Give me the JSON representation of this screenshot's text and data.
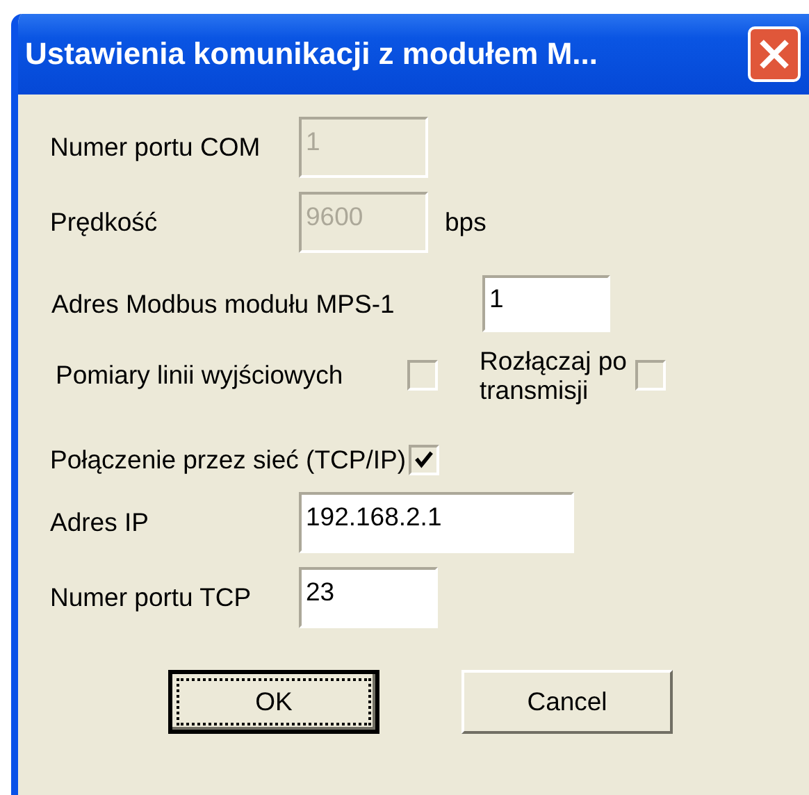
{
  "window": {
    "title": "Ustawienia komunikacji z modułem M..."
  },
  "com_port": {
    "label": "Numer portu COM",
    "value": "1",
    "disabled": true
  },
  "speed": {
    "label": "Prędkość",
    "value": "9600",
    "unit": "bps",
    "disabled": true
  },
  "modbus_address": {
    "label": "Adres Modbus modułu MPS-1",
    "value": "1",
    "disabled": false
  },
  "output_line_measurements": {
    "label": "Pomiary linii wyjściowych",
    "checked": false
  },
  "disconnect_after_transmission": {
    "label": "Rozłączaj po transmisji",
    "checked": false
  },
  "network_connection": {
    "label": "Połączenie przez sieć (TCP/IP)",
    "checked": true
  },
  "ip_address": {
    "label": "Adres IP",
    "value": "192.168.2.1",
    "disabled": false
  },
  "tcp_port": {
    "label": "Numer portu TCP",
    "value": "23",
    "disabled": false
  },
  "buttons": [
    {
      "label": "OK",
      "focused": true
    },
    {
      "label": "Cancel",
      "focused": false
    }
  ]
}
